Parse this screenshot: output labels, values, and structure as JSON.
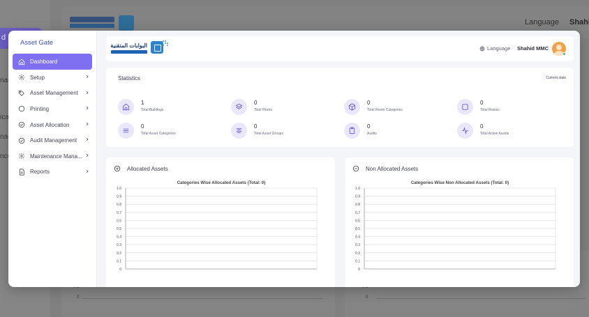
{
  "background": {
    "sidebar_active_label": "d",
    "sidebar_fragments": [
      "nag",
      "ica",
      "nag",
      "nce"
    ],
    "language": "Language",
    "user": "Shahid",
    "axis_labels": [
      "0.1",
      "0"
    ]
  },
  "sidebar": {
    "title": "Asset Gate",
    "items": [
      {
        "label": "Dashboard",
        "icon": "home-icon",
        "active": true,
        "has_submenu": false
      },
      {
        "label": "Setup",
        "icon": "gear-icon",
        "has_submenu": true
      },
      {
        "label": "Asset Management",
        "icon": "tag-icon",
        "has_submenu": true
      },
      {
        "label": "Printing",
        "icon": "circle-icon",
        "has_submenu": true
      },
      {
        "label": "Asset Allocation",
        "icon": "check-circle-icon",
        "has_submenu": true
      },
      {
        "label": "Audit Management",
        "icon": "check-circle-icon",
        "has_submenu": true
      },
      {
        "label": "Maintenance Mana...",
        "icon": "gear-icon",
        "has_submenu": true
      },
      {
        "label": "Reports",
        "icon": "document-icon",
        "has_submenu": true
      }
    ]
  },
  "header": {
    "logo_text": "البوابات المتقنية",
    "language": "Language",
    "user_name": "Shahid MMC"
  },
  "statistics": {
    "title": "Statistics",
    "right_label": "Current stats",
    "items": [
      {
        "value": "1",
        "label": "Total Buildings",
        "icon": "building-icon"
      },
      {
        "value": "0",
        "label": "Total Floors",
        "icon": "layers-icon"
      },
      {
        "value": "0",
        "label": "Total Room Categories",
        "icon": "box-icon"
      },
      {
        "value": "0",
        "label": "Total Rooms",
        "icon": "square-icon"
      },
      {
        "value": "0",
        "label": "Total Asset Categories",
        "icon": "list-icon"
      },
      {
        "value": "0",
        "label": "Total Asset Groups",
        "icon": "align-center-icon"
      },
      {
        "value": "0",
        "label": "Audits",
        "icon": "clipboard-icon"
      },
      {
        "value": "0",
        "label": "Total Active Assets",
        "icon": "activity-icon"
      }
    ]
  },
  "allocated": {
    "header": "Allocated Assets",
    "icon": "plus-circle-icon"
  },
  "non_allocated": {
    "header": "Non Allocated Assets",
    "icon": "minus-circle-icon"
  },
  "chart_data": [
    {
      "type": "bar",
      "title": "Categories Wise Allocated Assets (Total: 0)",
      "categories": [],
      "values": [],
      "yticks": [
        "1.0",
        "0.9",
        "0.8",
        "0.7",
        "0.6",
        "0.5",
        "0.4",
        "0.3",
        "0.2",
        "0.1",
        "0"
      ],
      "ylim": [
        0,
        1
      ],
      "grid": true
    },
    {
      "type": "bar",
      "title": "Categories Wise Non Allocated Assets (Total: 0)",
      "categories": [],
      "values": [],
      "yticks": [
        "1.0",
        "0.9",
        "0.8",
        "0.7",
        "0.6",
        "0.5",
        "0.4",
        "0.3",
        "0.2",
        "0.1",
        "0"
      ],
      "ylim": [
        0,
        1
      ],
      "grid": true
    }
  ],
  "colors": {
    "accent": "#7e70f0",
    "sidebar_title": "#3f51b5",
    "icon_bg": "#e9e7fb",
    "online": "#3cc46a"
  }
}
